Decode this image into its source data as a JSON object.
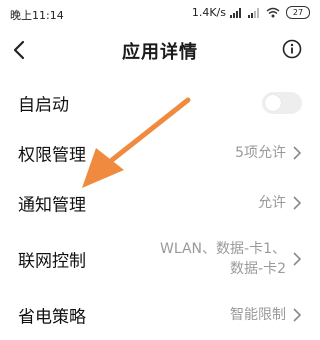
{
  "status_bar": {
    "time": "晚上11:14",
    "net_speed": "1.4K/s",
    "battery": "27"
  },
  "header": {
    "title": "应用详情"
  },
  "rows": [
    {
      "label": "自启动",
      "value": "",
      "type": "toggle"
    },
    {
      "label": "权限管理",
      "value": "5项允许",
      "type": "link"
    },
    {
      "label": "通知管理",
      "value": "允许",
      "type": "link"
    },
    {
      "label": "联网控制",
      "value_line1": "WLAN、数据-卡1、",
      "value_line2": "数据-卡2",
      "type": "link"
    },
    {
      "label": "省电策略",
      "value": "智能限制",
      "type": "link"
    }
  ],
  "colors": {
    "arrow": "#f08a3e",
    "secondary_text": "#9a9a9a",
    "toggle_off": "#eeeeee"
  },
  "icons": [
    "signal-icon",
    "wifi-icon",
    "battery-icon",
    "back-icon",
    "info-icon",
    "chevron-right-icon",
    "annotation-arrow"
  ]
}
